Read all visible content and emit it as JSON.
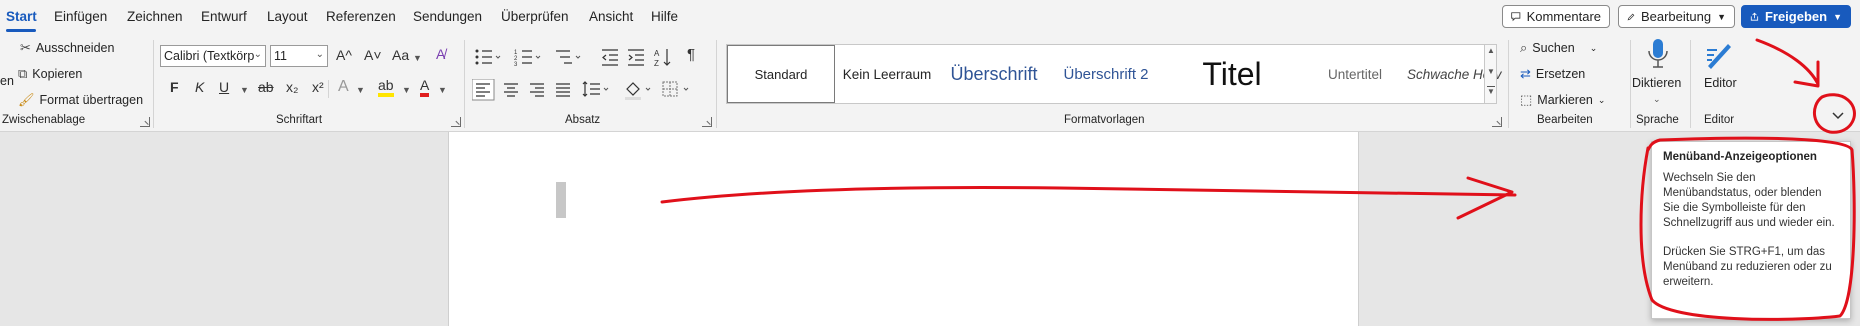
{
  "tabs": [
    "Start",
    "Einfügen",
    "Zeichnen",
    "Entwurf",
    "Layout",
    "Referenzen",
    "Sendungen",
    "Überprüfen",
    "Ansicht",
    "Hilfe"
  ],
  "topright": {
    "comments": "Kommentare",
    "editing": "Bearbeitung",
    "share": "Freigeben"
  },
  "clipboard": {
    "label": "Zwischenablage",
    "cut": "Ausschneiden",
    "copy": "Kopieren",
    "format_painter": "Format übertragen",
    "paste_partial": "en"
  },
  "font": {
    "label": "Schriftart",
    "name": "Calibri (Textkörp",
    "size": "11",
    "bold": "F",
    "italic": "K",
    "underline": "U",
    "strike": "ab",
    "subscript": "x₂",
    "superscript": "x²",
    "grow": "A^",
    "shrink": "A˅",
    "case": "Aa",
    "effects": "A",
    "highlight": "ab",
    "color": "A"
  },
  "paragraph": {
    "label": "Absatz",
    "pilcrow": "¶"
  },
  "styles": {
    "label": "Formatvorlagen",
    "items": [
      "Standard",
      "Kein Leerraum",
      "Überschrift",
      "Überschrift 2",
      "Titel",
      "Untertitel",
      "Schwache Herv"
    ]
  },
  "editing": {
    "label": "Bearbeiten",
    "find": "Suchen",
    "replace": "Ersetzen",
    "select": "Markieren"
  },
  "voice": {
    "label": "Sprache",
    "dictate": "Diktieren"
  },
  "editor": {
    "label": "Editor",
    "button": "Editor"
  },
  "tooltip": {
    "title": "Menüband-Anzeigeoptionen",
    "body1": "Wechseln Sie den Menübandstatus, oder blenden Sie die Symbolleiste für den Schnellzugriff aus und wieder ein.",
    "body2": "Drücken Sie STRG+F1, um das Menüband zu reduzieren oder zu erweitern."
  },
  "colors": {
    "accent": "#185abd",
    "annotation": "#e0101a",
    "highlight": "#ffe500",
    "font_color": "#e01e1e"
  }
}
